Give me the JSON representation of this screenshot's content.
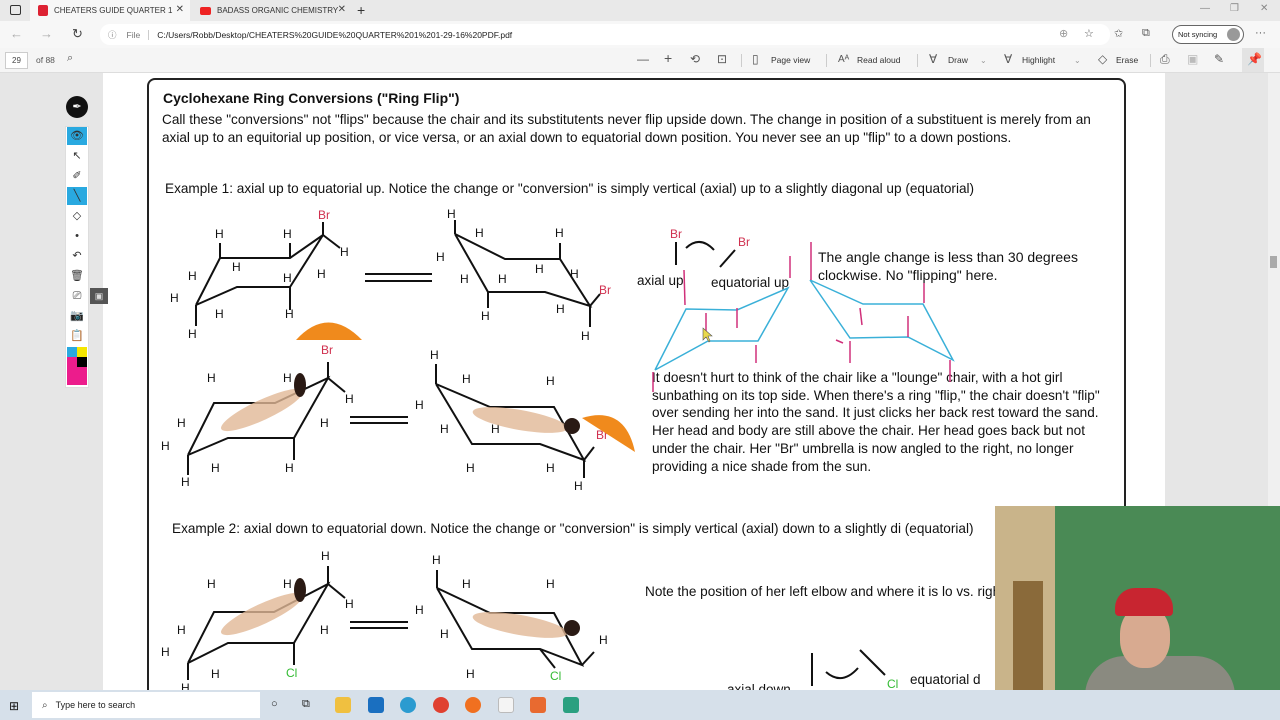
{
  "browser": {
    "tabs": [
      {
        "title": "CHEATERS GUIDE QUARTER 1",
        "icon": "pdf-icon",
        "active": true
      },
      {
        "title": "BADASS ORGANIC CHEMISTRY",
        "icon": "youtube-icon",
        "active": false
      }
    ],
    "new_tab": "+",
    "address": {
      "info_icon": "ⓘ",
      "scheme_label": "File",
      "url": "C:/Users/Robb/Desktop/CHEATERS%20GUIDE%20QUARTER%201%201-29-16%20PDF.pdf"
    },
    "sync_label": "Not syncing",
    "more": "···"
  },
  "pdf_toolbar": {
    "page_current": "29",
    "page_total": "of 88",
    "zoom_out": "—",
    "zoom_in": "+",
    "page_view": "Page view",
    "read_aloud": "Read aloud",
    "draw": "Draw",
    "highlight": "Highlight",
    "erase": "Erase"
  },
  "document": {
    "title": "Cyclohexane Ring Conversions (\"Ring Flip\")",
    "intro": "Call these \"conversions\" not \"flips\" because the chair and its substitutents never flip upside down. The change in position of a substituent is merely from an axial up to an equitorial up position, or vice versa, or an axial down to equatorial down position. You never see an up \"flip\" to a down postions.",
    "example1": "Example 1: axial up to equatorial up. Notice the change or \"conversion\" is simply vertical (axial) up to a slightly diagonal up (equatorial)",
    "angle_note": "The angle change is less than 30 degrees clockwise. No \"flipping\" here.",
    "axial_up": "axial up",
    "equatorial_up": "equatorial up",
    "lounge_note": "It doesn't hurt to think of the chair like a \"lounge\" chair, with a hot girl sunbathing on its top side. When there's a ring \"flip,\" the chair doesn't \"flip\" over sending her into the sand. It just clicks her back rest toward the sand. Her head and body are still above the chair. Her head goes back but not under the chair. Her \"Br\" umbrella is now angled to the right, no longer providing a nice shade from the sun.",
    "example2": "Example 2: axial down to equatorial down. Notice the change or \"conversion\" is simply vertical (axial) down to a slightly di (equatorial)",
    "elbow_note": "Note the position of her left elbow and where it is lo vs. right chair conformations. Familiarity with human will guide you to the correct position every time.",
    "axial_down": "axial down",
    "equatorial_down": "equatorial d",
    "atoms": {
      "H": "H",
      "Br": "Br",
      "Cl": "Cl"
    }
  },
  "annotation_tools": [
    "pen-logo",
    "view",
    "select",
    "marker",
    "pen",
    "eraser",
    "dot",
    "undo",
    "trash",
    "screen",
    "camera",
    "clipboard"
  ],
  "colors": {
    "accent": "#29a9e0",
    "br": "#d0304f",
    "cl": "#33bb33",
    "sketch_cyan": "#3ab0d8",
    "sketch_magenta": "#d0307a"
  },
  "taskbar": {
    "search_placeholder": "Type here to search"
  }
}
